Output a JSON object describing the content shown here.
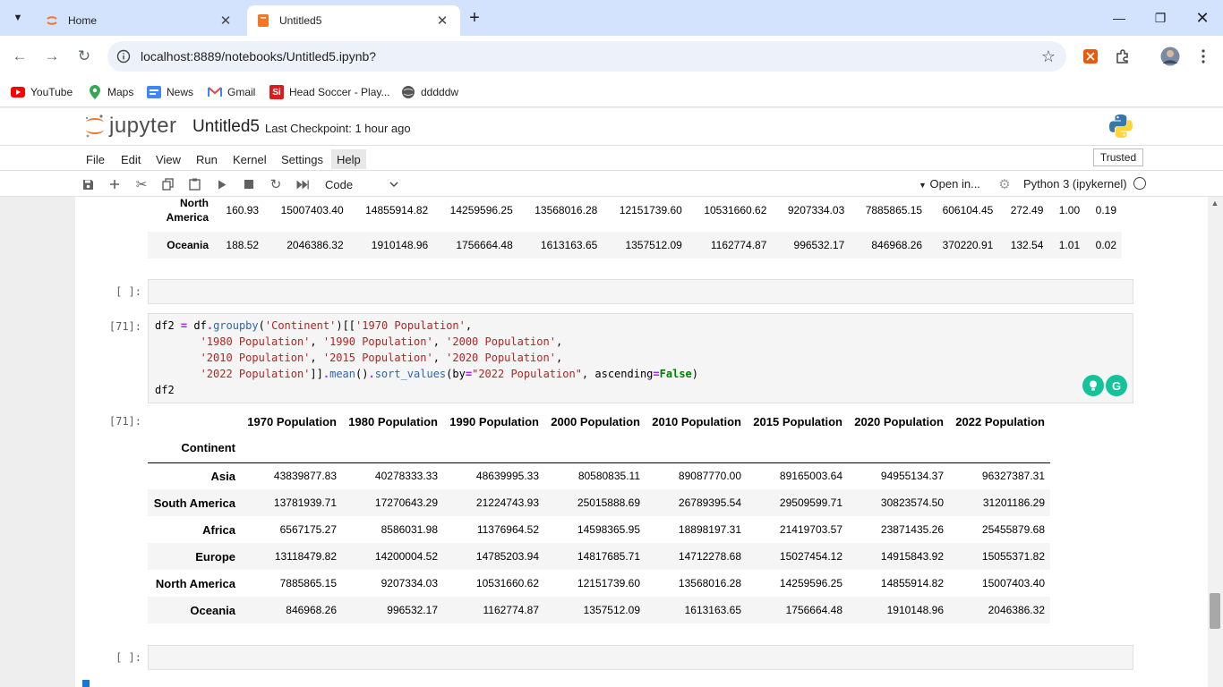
{
  "browser": {
    "tabs": [
      {
        "title": "Home",
        "active": false
      },
      {
        "title": "Untitled5",
        "active": true
      }
    ],
    "url": "localhost:8889/notebooks/Untitled5.ipynb?",
    "bookmarks": [
      "YouTube",
      "Maps",
      "News",
      "Gmail",
      "Head Soccer - Play...",
      "dddddw"
    ]
  },
  "jupyter": {
    "logo_text": "jupyter",
    "notebook_title": "Untitled5",
    "checkpoint": "Last Checkpoint: 1 hour ago",
    "menu": [
      "File",
      "Edit",
      "View",
      "Run",
      "Kernel",
      "Settings",
      "Help"
    ],
    "trusted": "Trusted",
    "cell_type": "Code",
    "open_in": "Open in...",
    "kernel": "Python 3 (ipykernel)"
  },
  "prev_output": {
    "rows": [
      {
        "label": "North America",
        "values": [
          "160.93",
          "15007403.40",
          "14855914.82",
          "14259596.25",
          "13568016.28",
          "12151739.60",
          "10531660.62",
          "9207334.03",
          "7885865.15",
          "606104.45",
          "272.49",
          "1.00",
          "0.19"
        ]
      },
      {
        "label": "Oceania",
        "values": [
          "188.52",
          "2046386.32",
          "1910148.96",
          "1756664.48",
          "1613163.65",
          "1357512.09",
          "1162774.87",
          "996532.17",
          "846968.26",
          "370220.91",
          "132.54",
          "1.01",
          "0.02"
        ]
      }
    ]
  },
  "cells": {
    "empty_prompt": "[ ]:",
    "code_prompt": "[71]:",
    "output_prompt": "[71]:",
    "code_lines": [
      "df2 = df.groupby('Continent')[['1970 Population',",
      "       '1980 Population', '1990 Population', '2000 Population',",
      "       '2010 Population', '2015 Population', '2020 Population',",
      "       '2022 Population']].mean().sort_values(by=\"2022 Population\", ascending=False)",
      "df2"
    ]
  },
  "df2": {
    "columns": [
      "1970 Population",
      "1980 Population",
      "1990 Population",
      "2000 Population",
      "2010 Population",
      "2015 Population",
      "2020 Population",
      "2022 Population"
    ],
    "index_name": "Continent",
    "rows": [
      {
        "label": "Asia",
        "values": [
          "43839877.83",
          "40278333.33",
          "48639995.33",
          "80580835.11",
          "89087770.00",
          "89165003.64",
          "94955134.37",
          "96327387.31"
        ]
      },
      {
        "label": "South America",
        "values": [
          "13781939.71",
          "17270643.29",
          "21224743.93",
          "25015888.69",
          "26789395.54",
          "29509599.71",
          "30823574.50",
          "31201186.29"
        ]
      },
      {
        "label": "Africa",
        "values": [
          "6567175.27",
          "8586031.98",
          "11376964.52",
          "14598365.95",
          "18898197.31",
          "21419703.57",
          "23871435.26",
          "25455879.68"
        ]
      },
      {
        "label": "Europe",
        "values": [
          "13118479.82",
          "14200004.52",
          "14785203.94",
          "14817685.71",
          "14712278.68",
          "15027454.12",
          "14915843.92",
          "15055371.82"
        ]
      },
      {
        "label": "North America",
        "values": [
          "7885865.15",
          "9207334.03",
          "10531660.62",
          "12151739.60",
          "13568016.28",
          "14259596.25",
          "14855914.82",
          "15007403.40"
        ]
      },
      {
        "label": "Oceania",
        "values": [
          "846968.26",
          "996532.17",
          "1162774.87",
          "1357512.09",
          "1613163.65",
          "1756664.48",
          "1910148.96",
          "2046386.32"
        ]
      }
    ]
  }
}
